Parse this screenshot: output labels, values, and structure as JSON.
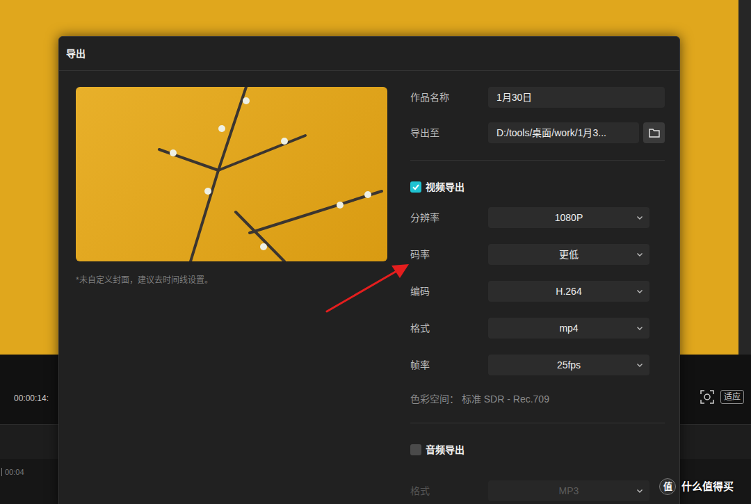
{
  "editor": {
    "timecode": "00:00:14:",
    "ruler_mark": "00:04",
    "fit_button": "适应"
  },
  "dialog": {
    "title": "导出",
    "cover_note": "*未自定义封面，建议去时间线设置。",
    "fields": [
      {
        "label": "作品名称",
        "value": "1月30日",
        "kind": "text"
      },
      {
        "label": "导出至",
        "value": "D:/tools/桌面/work/1月3...",
        "kind": "path"
      }
    ],
    "video_export": {
      "label": "视频导出",
      "checked": true,
      "settings": [
        {
          "label": "分辨率",
          "value": "1080P",
          "disabled": false
        },
        {
          "label": "码率",
          "value": "更低",
          "disabled": false
        },
        {
          "label": "编码",
          "value": "H.264",
          "disabled": false
        },
        {
          "label": "格式",
          "value": "mp4",
          "disabled": false
        },
        {
          "label": "帧率",
          "value": "25fps",
          "disabled": false
        }
      ],
      "color_space": "色彩空间： 标准 SDR - Rec.709"
    },
    "audio_export": {
      "label": "音频导出",
      "checked": false,
      "settings": [
        {
          "label": "格式",
          "value": "MP3",
          "disabled": true
        }
      ]
    }
  },
  "watermark": {
    "badge": "值",
    "text": "什么值得买"
  }
}
